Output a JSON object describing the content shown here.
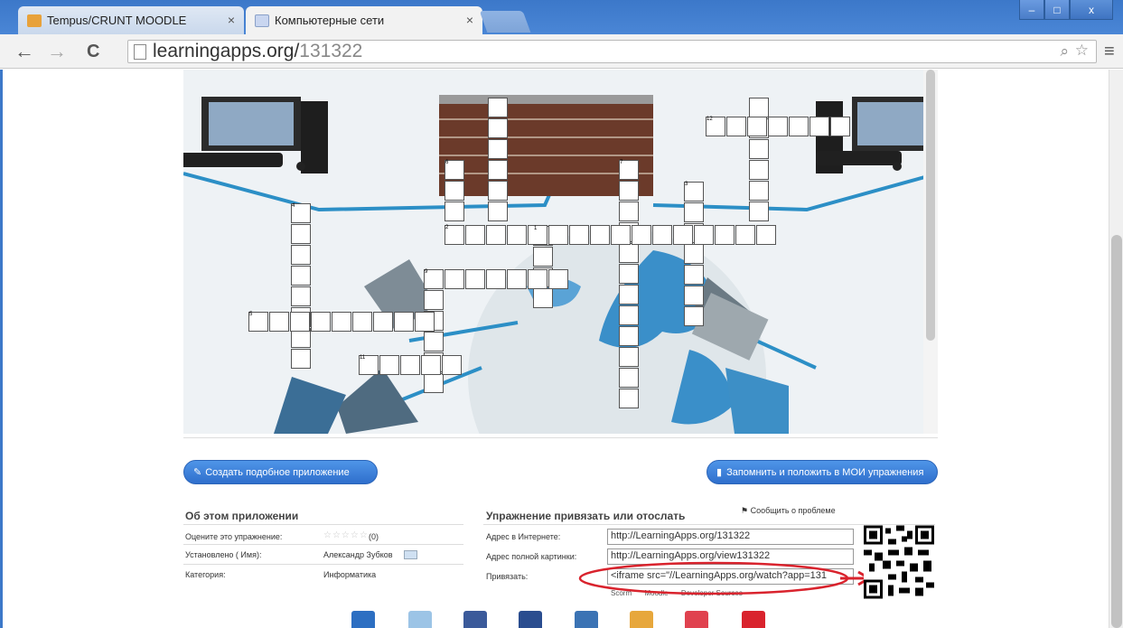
{
  "tabs": [
    {
      "label": "Tempus/CRUNT MOODLE",
      "close": "×",
      "active": false
    },
    {
      "label": "Компьютерные сети",
      "close": "×",
      "active": true
    }
  ],
  "window_controls": {
    "minimize": "–",
    "maximize": "□",
    "close": "x"
  },
  "toolbar": {
    "back": "←",
    "forward": "→",
    "reload": "C",
    "menu": "≡"
  },
  "address": {
    "domain": "learningapps.org/",
    "path": "131322"
  },
  "crossword_numbers": [
    "12",
    "6",
    "7",
    "3",
    "4",
    "2",
    "1",
    "9",
    "5",
    "11"
  ],
  "actions": {
    "create_similar": "Создать подобное приложение",
    "remember": "Запомнить и положить в МОИ упражнения"
  },
  "about": {
    "title": "Об этом приложении",
    "rate_label": "Оцените это упражнение:",
    "rating_count": "(0)",
    "author_label": "Установлено ( Имя):",
    "author": "Александр Зубков",
    "category_label": "Категория:",
    "category": "Информатика"
  },
  "embed": {
    "title": "Упражнение привязать или отослать",
    "report": "Сообщить о проблеме",
    "web_label": "Адрес в Интернете:",
    "web_value": "http://LearningApps.org/131322",
    "full_label": "Адрес полной картинки:",
    "full_value": "http://LearningApps.org/view131322",
    "bind_label": "Привязать:",
    "bind_value": "<iframe src=\"//LearningApps.org/watch?app=131",
    "sub_links": [
      "Scorm",
      "Moodle",
      "Developer Sources"
    ]
  },
  "colors": {
    "accent_blue": "#2f6fcc",
    "annotation_red": "#d9232d",
    "titlebar": "#3c78c9"
  }
}
